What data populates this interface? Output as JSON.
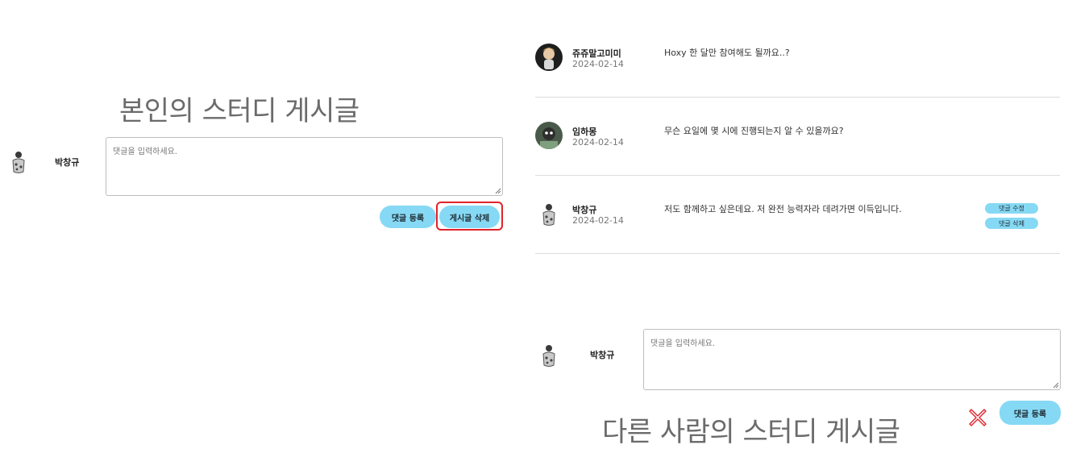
{
  "left_panel": {
    "caption": "본인의 스터디 게시글",
    "user_name": "박창규",
    "comment_input": {
      "placeholder": "댓글을 입력하세요.",
      "value": ""
    },
    "register_label": "댓글 등록",
    "delete_post_label": "게시글 삭제"
  },
  "right_panel": {
    "comments": [
      {
        "name": "쥬쥬말고미미",
        "date": "2024-02-14",
        "text": "Hoxy 한 달만 참여해도 될까요..?"
      },
      {
        "name": "임하몽",
        "date": "2024-02-14",
        "text": "무슨 요일에 몇 시에 진행되는지 알 수 있을까요?"
      },
      {
        "name": "박창규",
        "date": "2024-02-14",
        "text": "저도 함께하고 싶은데요. 저 완전 능력자라 데려가면 이득입니다.",
        "edit_label": "댓글 수정",
        "delete_label": "댓글 삭제"
      }
    ],
    "user_name": "박창규",
    "comment_input": {
      "placeholder": "댓글을 입력하세요.",
      "value": ""
    },
    "register_label": "댓글 등록",
    "caption": "다른 사람의 스터디 게시글"
  },
  "colors": {
    "button": "#86d9f4",
    "highlight": "#e0242a",
    "caption": "#6b6b6b",
    "divider": "#dcdcdc"
  },
  "icons": [
    "user-avatar-icon",
    "resize-grip-icon",
    "cross-mark-icon"
  ]
}
